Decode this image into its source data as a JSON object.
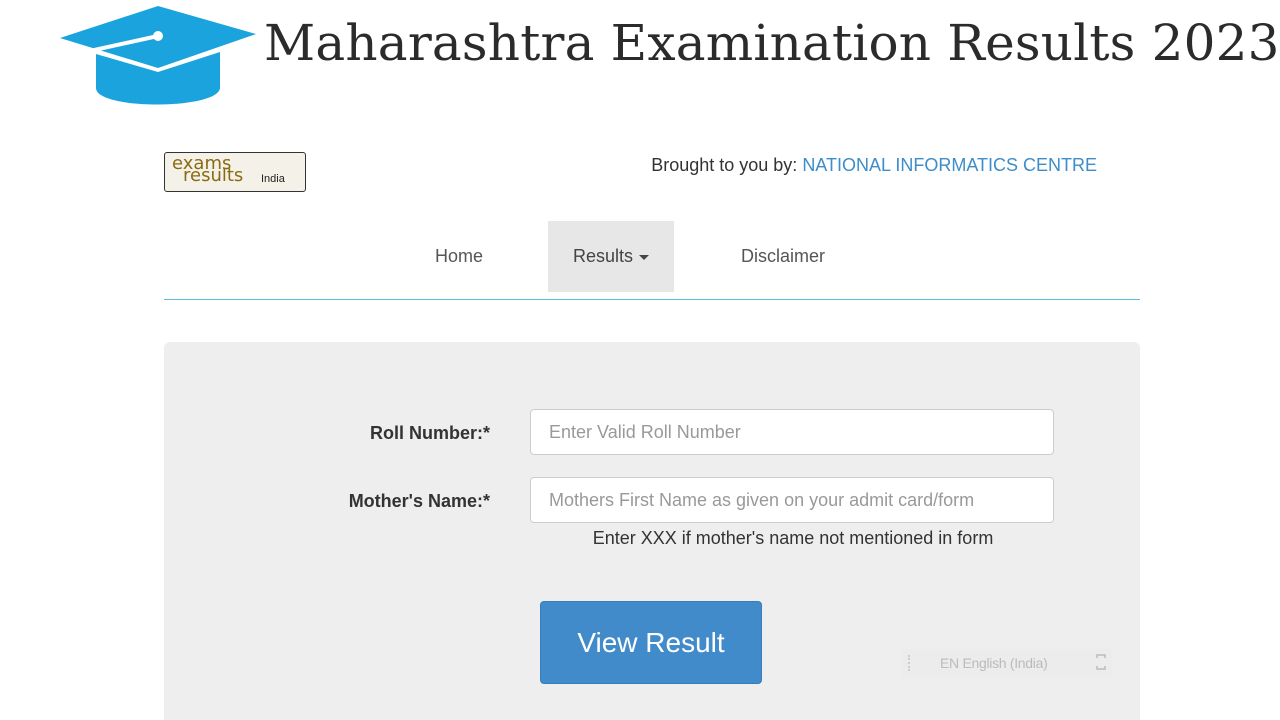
{
  "header": {
    "title": "Maharashtra Examination Results 2023",
    "icon": "graduation-cap-icon",
    "icon_color": "#1aa3dd"
  },
  "logo": {
    "line1": "exams",
    "line2": "results",
    "line3": "India"
  },
  "credit": {
    "prefix": "Brought to you by: ",
    "org": "NATIONAL INFORMATICS CENTRE"
  },
  "nav": {
    "home": "Home",
    "results": "Results",
    "disclaimer": "Disclaimer"
  },
  "form": {
    "roll_label": "Roll Number:*",
    "roll_placeholder": "Enter Valid Roll Number",
    "roll_value": "",
    "mother_label": "Mother's Name:*",
    "mother_placeholder": "Mothers First Name as given on your admit card/form",
    "mother_value": "",
    "mother_hint": "Enter XXX if mother's name not mentioned in form",
    "submit_label": "View Result"
  },
  "language_bar": {
    "label": "EN English (India)"
  },
  "colors": {
    "accent": "#428bca",
    "link": "#3c8dca",
    "nav_rule": "#5bc0de"
  }
}
